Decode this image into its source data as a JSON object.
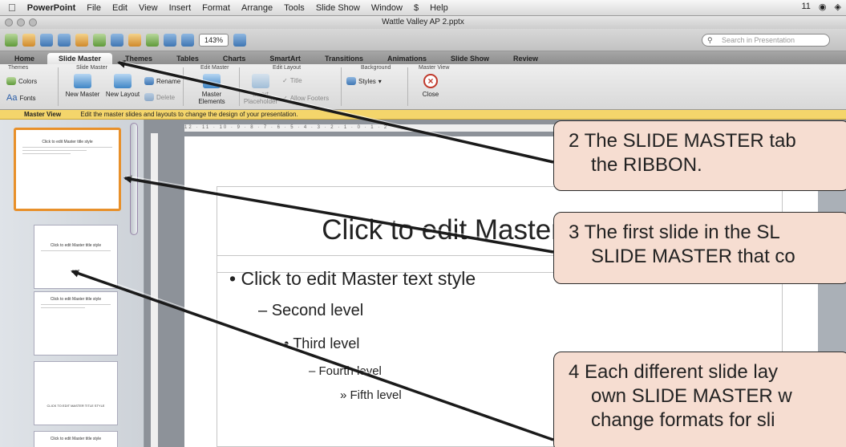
{
  "menubar": {
    "app": "PowerPoint",
    "items": [
      "File",
      "Edit",
      "View",
      "Insert",
      "Format",
      "Arrange",
      "Tools",
      "Slide Show",
      "Window",
      "Help"
    ],
    "script_icon": "$",
    "status": "11"
  },
  "window": {
    "title": "Wattle Valley AP 2.pptx"
  },
  "toolbar": {
    "zoom": "143%",
    "search_placeholder": "Search in Presentation"
  },
  "tabs": [
    "Home",
    "Slide Master",
    "Themes",
    "Tables",
    "Charts",
    "SmartArt",
    "Transitions",
    "Animations",
    "Slide Show",
    "Review"
  ],
  "ribbon": {
    "groups": [
      "Themes",
      "Slide Master",
      "Edit Master",
      "Edit Layout",
      "Background",
      "Master View"
    ],
    "colors_label": "Colors",
    "fonts_label": "Fonts",
    "new_master": "New Master",
    "new_layout": "New Layout",
    "rename": "Rename",
    "delete": "Delete",
    "master_elements": "Master Elements",
    "insert_placeholder": "Insert Placeholder",
    "title_chk": "Title",
    "footers_chk": "Allow Footers",
    "styles": "Styles",
    "close": "Close"
  },
  "master_view": {
    "label": "Master View",
    "hint": "Edit the master slides and layouts to change the design of your presentation."
  },
  "thumbnails": [
    {
      "title": "Click to edit Master title style"
    },
    {
      "title": "Click to edit Master title style"
    },
    {
      "title": "Click to edit Master title style"
    },
    {
      "title": "CLICK TO EDIT MASTER TITLE STYLE"
    },
    {
      "title": "Click to edit Master title style"
    }
  ],
  "ruler": {
    "ticks": "12 · 11 · 10 · 9 · 8 · 7 · 6 · 5 · 4 · 3 · 2 · 1 · 0 · 1 · 2"
  },
  "slide": {
    "title": "Click to edit Master title style",
    "level1": "Click to edit Master text style",
    "level2": "Second level",
    "level3": "Third level",
    "level4": "Fourth level",
    "level5": "Fifth level"
  },
  "callouts": {
    "c2_line1": "2  The SLIDE MASTER tab",
    "c2_line2": "the RIBBON.",
    "c3_line1": "3  The first slide in the SL",
    "c3_line2": "SLIDE MASTER that co",
    "c4_line1": "4  Each different slide lay",
    "c4_line2": "own SLIDE MASTER w",
    "c4_line3": "change formats for sli"
  }
}
